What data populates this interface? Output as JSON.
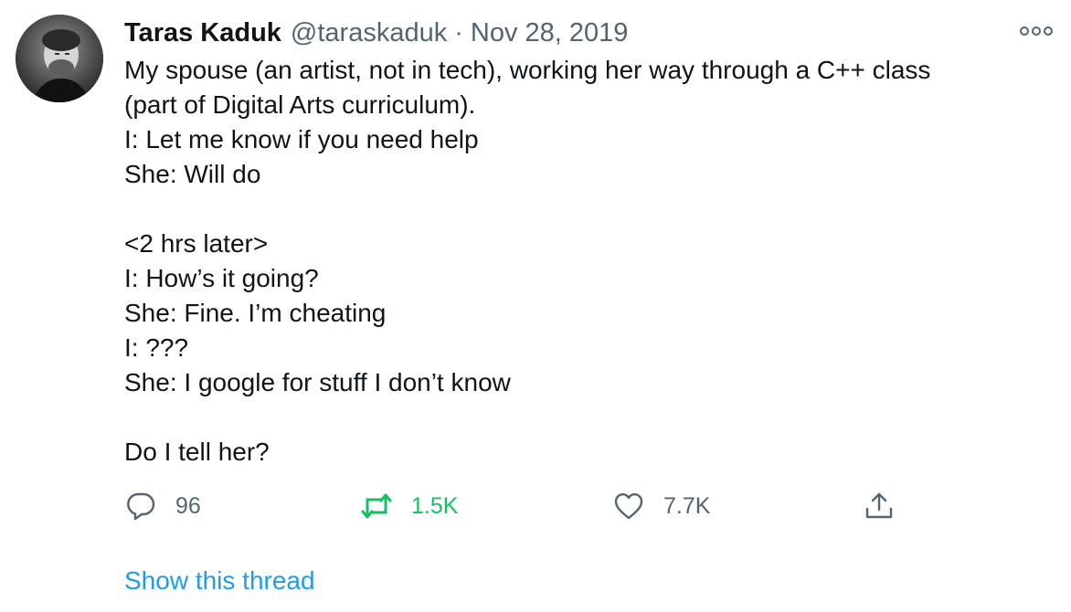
{
  "author": {
    "name": "Taras Kaduk",
    "handle": "@taraskaduk",
    "separator": "·",
    "date": "Nov 28, 2019"
  },
  "tweet": {
    "lines": [
      "My spouse (an artist, not in tech), working her way through a C++ class",
      "(part of Digital Arts curriculum).",
      "I: Let me know if you need help",
      "She: Will do",
      "",
      "<2 hrs later>",
      "I: How’s it going?",
      "She: Fine. I’m cheating",
      "I: ???",
      "She: I google for stuff I don’t know",
      "",
      "Do I tell her?"
    ]
  },
  "actions": {
    "reply": {
      "icon": "reply-icon",
      "count": "96"
    },
    "retweet": {
      "icon": "retweet-icon",
      "count": "1.5K",
      "color": "#17bf63"
    },
    "like": {
      "icon": "heart-icon",
      "count": "7.7K"
    },
    "share": {
      "icon": "share-icon"
    }
  },
  "footer": {
    "show_thread": "Show this thread",
    "link_color": "#1d9bf0"
  },
  "colors": {
    "text": "#0f1419",
    "secondary": "#536471",
    "retweet": "#17bf63",
    "link": "#1d9bf0"
  }
}
